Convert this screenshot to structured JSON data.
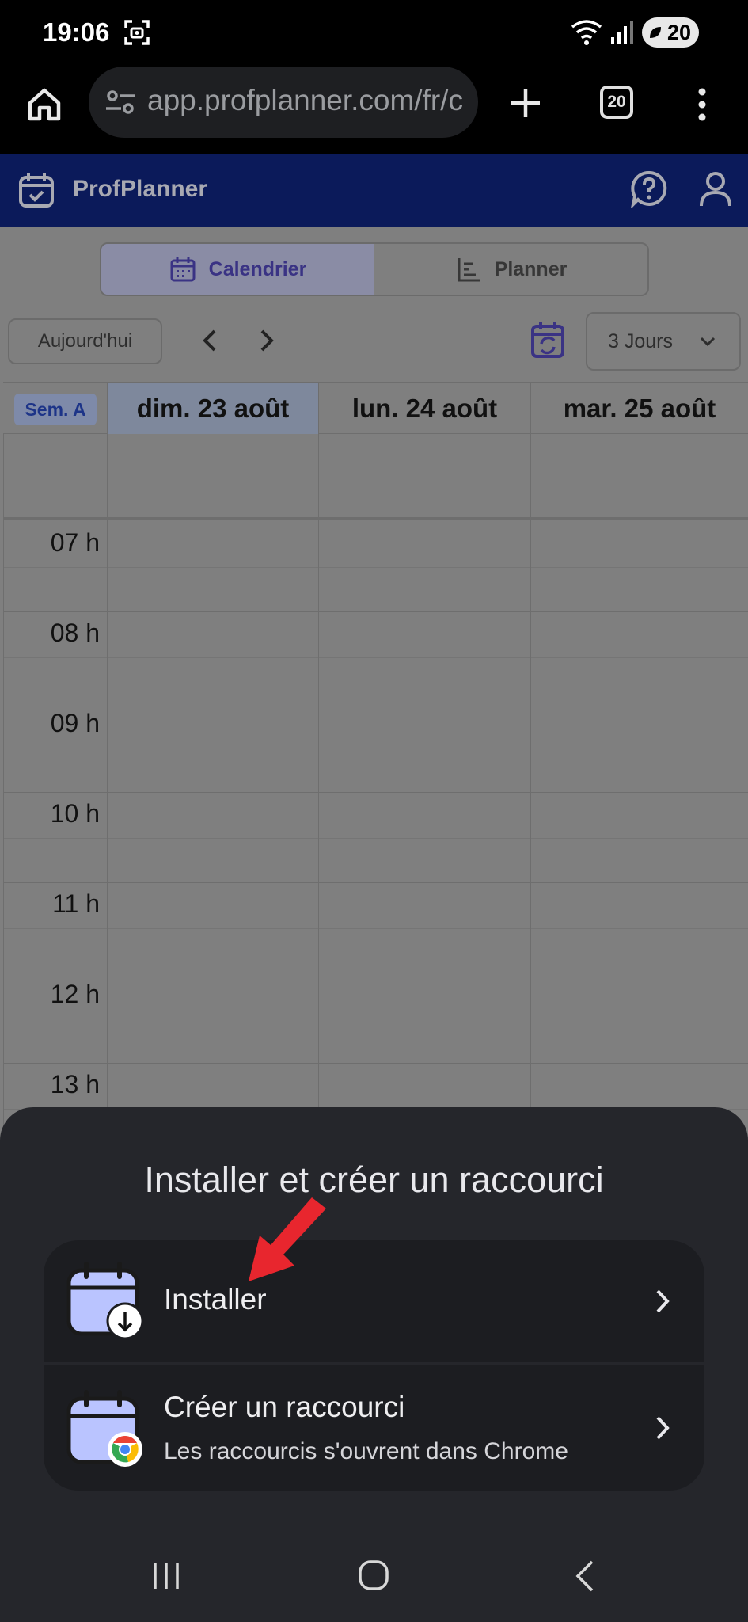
{
  "status_bar": {
    "time": "19:06",
    "battery": "20"
  },
  "browser": {
    "url": "app.profplanner.com/fr/c",
    "tab_count": "20"
  },
  "app": {
    "title": "ProfPlanner",
    "tabs": [
      {
        "label": "Calendrier",
        "active": true
      },
      {
        "label": "Planner",
        "active": false
      }
    ],
    "today_button": "Aujourd'hui",
    "view_select": "3 Jours",
    "week_label": "Sem. A",
    "days": [
      "dim. 23 août",
      "lun. 24 août",
      "mar. 25 août"
    ],
    "hours": [
      "07 h",
      "08 h",
      "09 h",
      "10 h",
      "11 h",
      "12 h",
      "13 h"
    ]
  },
  "sheet": {
    "title": "Installer et créer un raccourci",
    "options": [
      {
        "label": "Installer"
      },
      {
        "label": "Créer un raccourci",
        "sublabel": "Les raccourcis s'ouvrent dans Chrome"
      }
    ]
  },
  "colors": {
    "header": "#0b1a5a",
    "sheet": "#25262b",
    "accent_arrow": "#e8262e"
  }
}
